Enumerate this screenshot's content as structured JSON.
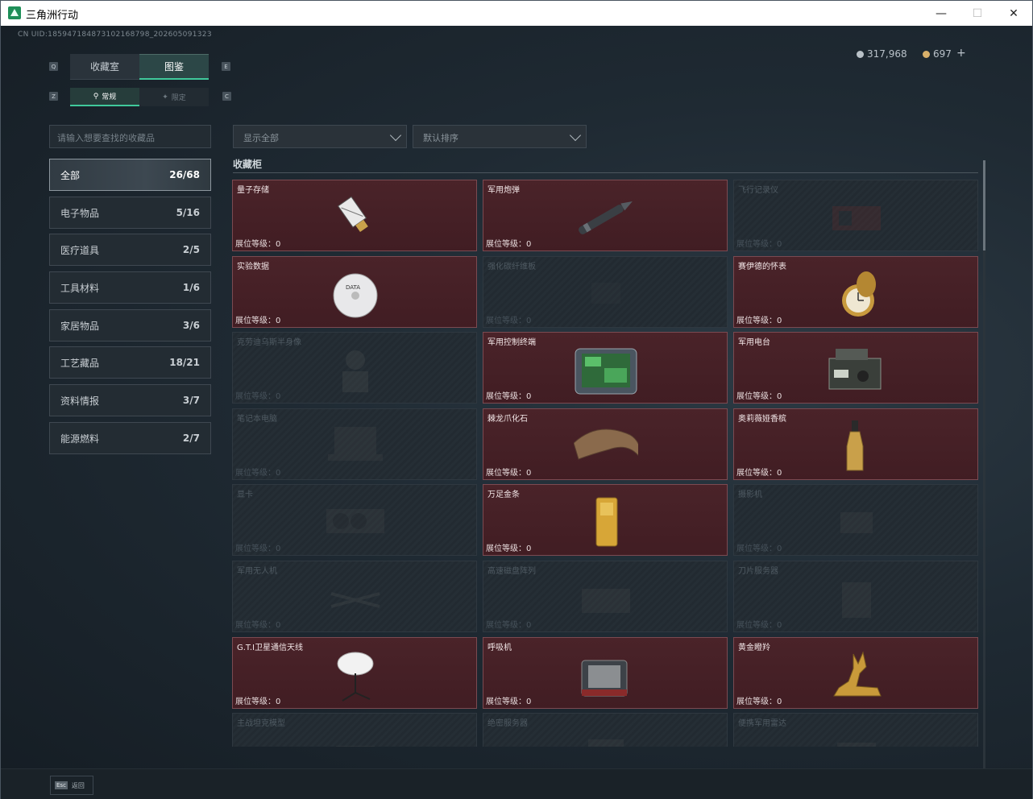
{
  "window": {
    "title": "三角洲行动",
    "minimize": "—",
    "maximize": "☐",
    "close": "✕"
  },
  "uid": "CN UID:1859471848731021687​98_202605091323",
  "currency": {
    "silver": "317,968",
    "gold": "697",
    "plus": "+"
  },
  "tabs": [
    {
      "label": "收藏室"
    },
    {
      "label": "图鉴"
    }
  ],
  "tab_keys": {
    "left": "Q",
    "right": "E"
  },
  "subtabs": [
    {
      "label": "常规"
    },
    {
      "label": "限定"
    }
  ],
  "subtab_keys": {
    "left": "Z",
    "right": "C"
  },
  "search": {
    "placeholder": "请输入想要查找的收藏品"
  },
  "filters": [
    {
      "value": "显示全部"
    },
    {
      "value": "默认排序"
    }
  ],
  "categories": [
    {
      "label": "全部",
      "count": "26/68"
    },
    {
      "label": "电子物品",
      "count": "5/16"
    },
    {
      "label": "医疗道具",
      "count": "2/5"
    },
    {
      "label": "工具材料",
      "count": "1/6"
    },
    {
      "label": "家居物品",
      "count": "3/6"
    },
    {
      "label": "工艺藏品",
      "count": "18/21"
    },
    {
      "label": "资料情报",
      "count": "3/7"
    },
    {
      "label": "能源燃料",
      "count": "2/7"
    }
  ],
  "section_title": "收藏柜",
  "items": [
    {
      "name": "量子存储",
      "level": "展位等级：0",
      "owned": true,
      "icon": "usb-drive-icon"
    },
    {
      "name": "军用炮弹",
      "level": "展位等级：0",
      "owned": true,
      "icon": "artillery-shell-icon"
    },
    {
      "name": "飞行记录仪",
      "level": "展位等级：0",
      "owned": false,
      "icon": "flight-recorder-icon"
    },
    {
      "name": "实验数据",
      "level": "展位等级：0",
      "owned": true,
      "icon": "disc-icon"
    },
    {
      "name": "强化碳纤维板",
      "level": "展位等级：0",
      "owned": false,
      "icon": "carbon-plate-icon"
    },
    {
      "name": "赛伊德的怀表",
      "level": "展位等级：0",
      "owned": true,
      "icon": "pocket-watch-icon"
    },
    {
      "name": "克劳迪乌斯半身像",
      "level": "展位等级：0",
      "owned": false,
      "icon": "bust-icon"
    },
    {
      "name": "军用控制终端",
      "level": "展位等级：0",
      "owned": true,
      "icon": "control-terminal-icon"
    },
    {
      "name": "军用电台",
      "level": "展位等级：0",
      "owned": true,
      "icon": "radio-icon"
    },
    {
      "name": "笔记本电脑",
      "level": "展位等级：0",
      "owned": false,
      "icon": "laptop-icon"
    },
    {
      "name": "棘龙爪化石",
      "level": "展位等级：0",
      "owned": true,
      "icon": "claw-fossil-icon"
    },
    {
      "name": "奥莉薇娅香槟",
      "level": "展位等级：0",
      "owned": true,
      "icon": "champagne-icon"
    },
    {
      "name": "显卡",
      "level": "展位等级：0",
      "owned": false,
      "icon": "graphics-card-icon"
    },
    {
      "name": "万足金条",
      "level": "展位等级：0",
      "owned": true,
      "icon": "gold-bar-icon"
    },
    {
      "name": "摄影机",
      "level": "展位等级：0",
      "owned": false,
      "icon": "camera-icon"
    },
    {
      "name": "军用无人机",
      "level": "展位等级：0",
      "owned": false,
      "icon": "drone-icon"
    },
    {
      "name": "高速磁盘阵列",
      "level": "展位等级：0",
      "owned": false,
      "icon": "disk-array-icon"
    },
    {
      "name": "刀片服务器",
      "level": "展位等级：0",
      "owned": false,
      "icon": "blade-server-icon"
    },
    {
      "name": "G.T.I卫星通信天线",
      "level": "展位等级：0",
      "owned": true,
      "icon": "satellite-dish-icon"
    },
    {
      "name": "呼吸机",
      "level": "展位等级：0",
      "owned": true,
      "icon": "ventilator-icon"
    },
    {
      "name": "黄金瞪羚",
      "level": "展位等级：0",
      "owned": true,
      "icon": "gold-gazelle-icon"
    },
    {
      "name": "主战坦克模型",
      "level": "",
      "owned": false,
      "icon": "tank-model-icon"
    },
    {
      "name": "绝密服务器",
      "level": "",
      "owned": false,
      "icon": "server-icon"
    },
    {
      "name": "便携军用雷达",
      "level": "",
      "owned": false,
      "icon": "radar-icon"
    }
  ],
  "footer": {
    "esc_key": "Esc",
    "esc_label": "返回"
  },
  "colors": {
    "accent": "#40c99b",
    "owned_card": "#4a2329",
    "locked_card": "#252e35"
  }
}
